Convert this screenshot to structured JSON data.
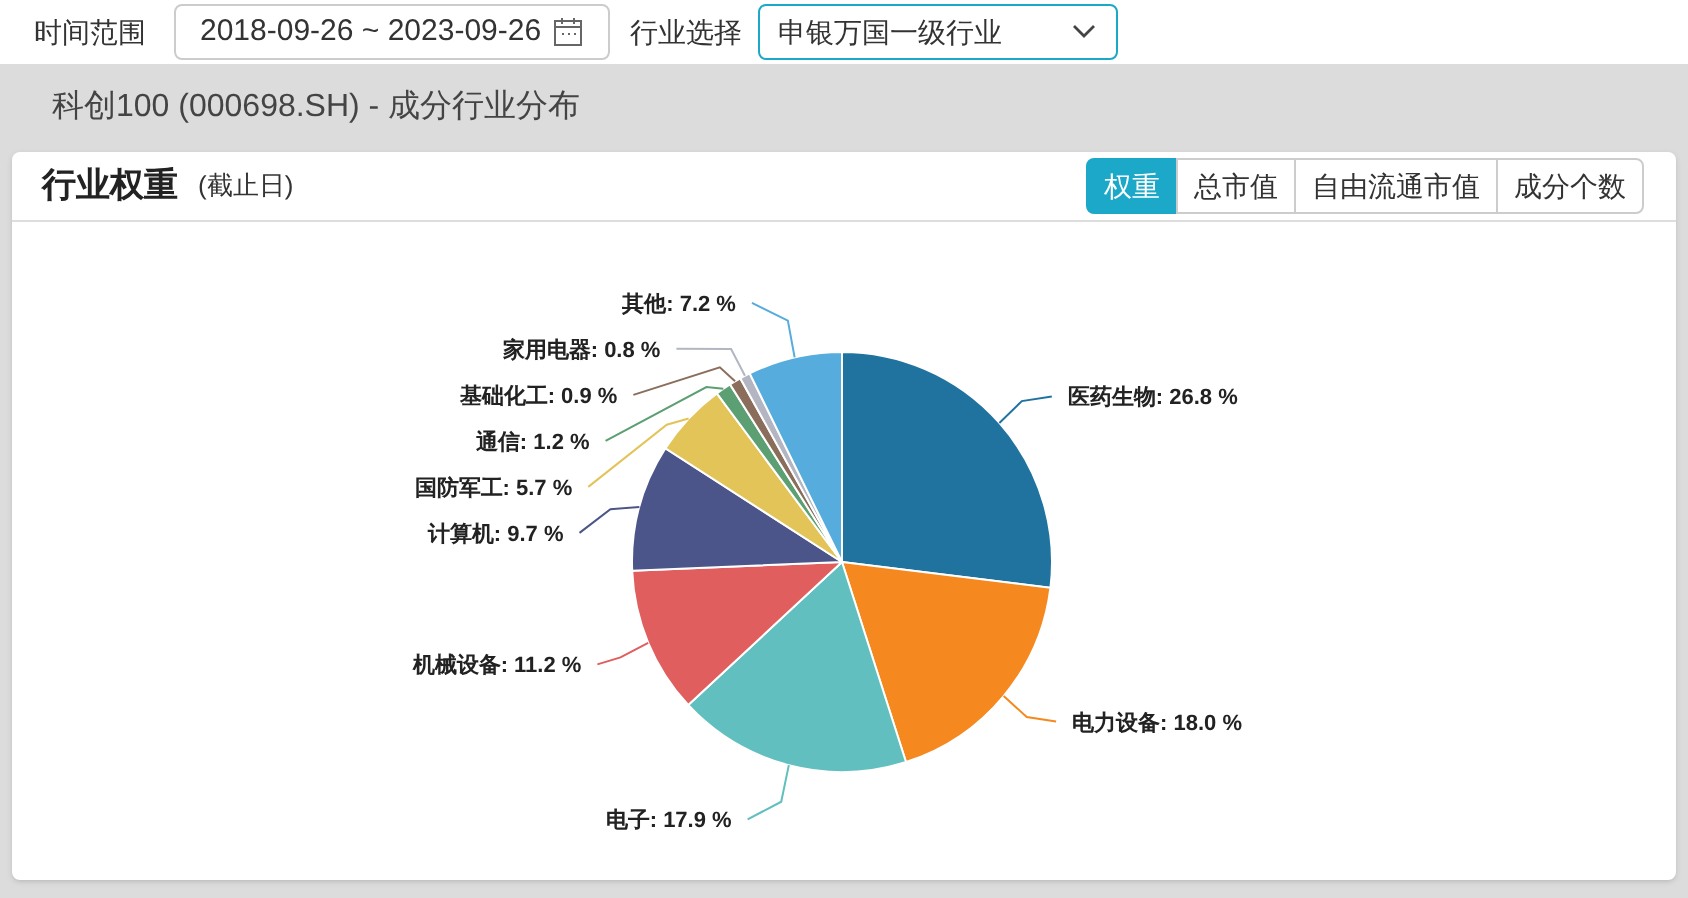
{
  "filters": {
    "date_label": "时间范围",
    "date_range": "2018-09-26 ~ 2023-09-26",
    "industry_label": "行业选择",
    "industry_value": "申银万国一级行业"
  },
  "page_title": "科创100 (000698.SH) - 成分行业分布",
  "card": {
    "title": "行业权重",
    "subtitle": "(截止日)",
    "tabs": [
      {
        "label": "权重",
        "selected": true
      },
      {
        "label": "总市值",
        "selected": false
      },
      {
        "label": "自由流通市值",
        "selected": false
      },
      {
        "label": "成分个数",
        "selected": false
      }
    ],
    "chart_data": {
      "type": "pie",
      "series": [
        {
          "values": [
            26.8,
            18.0,
            17.9,
            11.2,
            9.7,
            5.7,
            1.2,
            0.9,
            0.8,
            7.2
          ],
          "colors": [
            "#21739f",
            "#f5891f",
            "#61bfbf",
            "#e05e5e",
            "#4b5589",
            "#e2c458",
            "#5c9f72",
            "#8a6d5a",
            "#b3b6c2",
            "#55acdd"
          ]
        }
      ],
      "value_labels": [
        "医药生物: 26.8 %",
        "电力设备: 18.0 %",
        "电子: 17.9 %",
        "机械设备: 11.2 %",
        "计算机: 9.7 %",
        "国防军工: 5.7 %",
        "通信: 1.2 %",
        "基础化工: 0.9 %",
        "家用电器: 0.8 %",
        "其他: 7.2 %"
      ]
    }
  }
}
